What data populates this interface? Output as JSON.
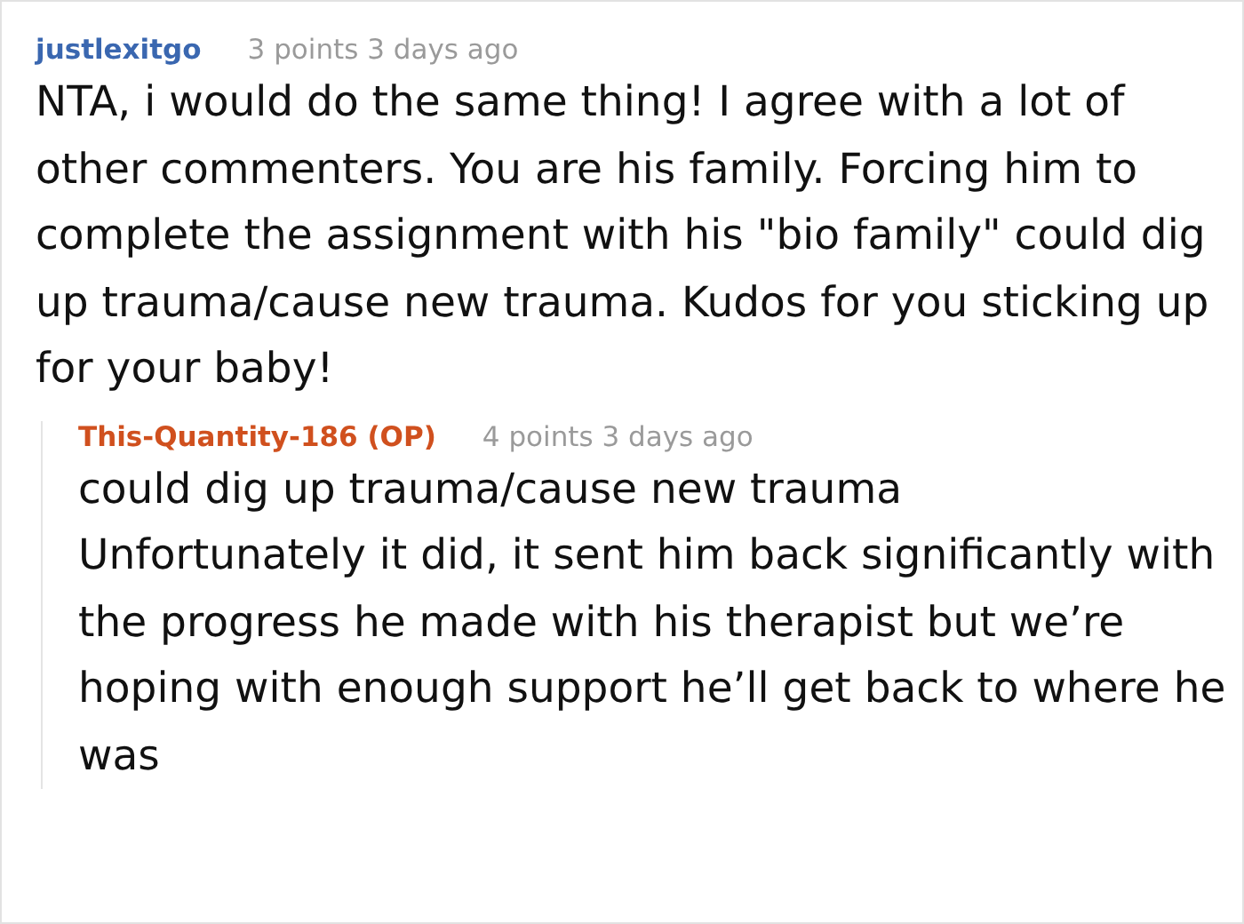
{
  "comments": [
    {
      "author": "justlexitgo",
      "is_op": false,
      "score": "3 points",
      "time": "3 days ago",
      "paragraphs": [
        "NTA, i would do the same thing! I agree with a lot of other commenters. You are his family. Forcing him to complete the assignment with his \"bio family\" could dig up trauma/cause new trauma. Kudos for you sticking up for your baby!"
      ],
      "replies": [
        {
          "author": "This-Quantity-186 (OP)",
          "is_op": true,
          "score": "4 points",
          "time": "3 days ago",
          "paragraphs": [
            "could dig up trauma/cause new trauma",
            "Unfortunately it did, it sent him back significantly with the progress he made with his therapist but we’re hoping with enough support he’ll get back to where he was"
          ]
        }
      ]
    }
  ]
}
